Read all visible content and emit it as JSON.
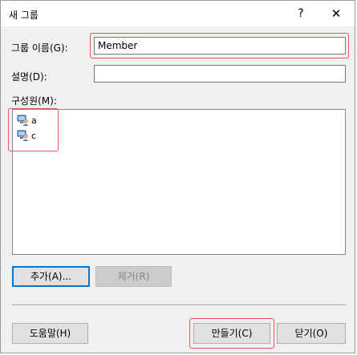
{
  "dialog": {
    "title": "새 그룹",
    "help_glyph": "?",
    "close_glyph": "✕"
  },
  "form": {
    "group_name_label": "그룹 이름(G):",
    "group_name_value": "Member",
    "description_label": "설명(D):",
    "description_value": "",
    "members_label": "구성원(M):",
    "members": [
      {
        "name": "a",
        "icon": "user-account-icon"
      },
      {
        "name": "c",
        "icon": "user-account-icon"
      }
    ]
  },
  "buttons": {
    "add": "추가(A)...",
    "remove": "제거(R)",
    "help": "도움말(H)",
    "create": "만들기(C)",
    "close": "닫기(O)"
  },
  "colors": {
    "highlight": "#e05a5a",
    "focus": "#0078d7"
  }
}
